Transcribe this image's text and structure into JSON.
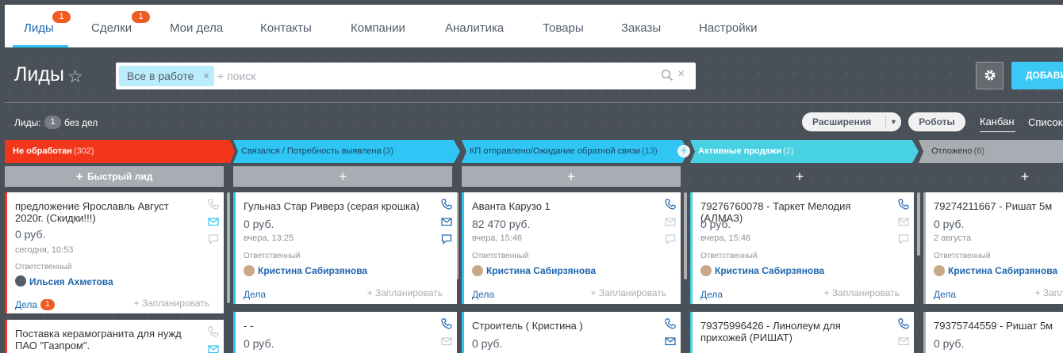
{
  "nav": {
    "tabs": [
      {
        "label": "Лиды",
        "badge": "1"
      },
      {
        "label": "Сделки",
        "badge": "1"
      },
      {
        "label": "Мои дела"
      },
      {
        "label": "Контакты"
      },
      {
        "label": "Компании"
      },
      {
        "label": "Аналитика"
      },
      {
        "label": "Товары"
      },
      {
        "label": "Заказы"
      },
      {
        "label": "Настройки"
      }
    ]
  },
  "page": {
    "title": "Лиды"
  },
  "filter": {
    "chip": "Все в работе",
    "chip_remove": "×",
    "placeholder": "+ поиск",
    "clear": "×"
  },
  "toolbar": {
    "add_label": "ДОБАВИТЬ"
  },
  "counter": {
    "label": "Лиды:",
    "value": "1",
    "suffix": "без дел"
  },
  "actions": {
    "extensions": "Расширения",
    "robots": "Роботы",
    "view_kanban": "Канбан",
    "view_list": "Список"
  },
  "colors": {
    "not_processed": "#f1361b",
    "contacted": "#2fc6f6",
    "proposal": "#2fc6f6",
    "active_sales": "#47d1e2",
    "postponed": "#a8adb4",
    "link": "#2067b0",
    "badge": "#f05b22"
  },
  "columns": [
    {
      "title": "Не обработан",
      "count": "(302)",
      "plus": "+",
      "quick_label": "Быстрый лид",
      "cards": [
        {
          "title": "предложение Ярославль Август 2020г. (Скидки!!!)",
          "sum": "0 руб.",
          "date": "сегодня, 10:53",
          "resp_label": "Ответственный",
          "resp": "Ильсия Ахметова",
          "deals": "Дела",
          "deals_badge": "1",
          "plan": "+ Запланировать"
        },
        {
          "title": "Поставка керамогранита для нужд ПАО \"Газпром\"."
        }
      ]
    },
    {
      "title": "Связался / Потребность выявлена",
      "count": "(3)",
      "plus": "+",
      "cards": [
        {
          "title": "Гульназ Стар Риверз (серая крошка)",
          "sum": "0 руб.",
          "date": "вчера, 13:25",
          "resp_label": "Ответственный",
          "resp": "Кристина Сабирзянова",
          "deals": "Дела",
          "plan": "+ Запланировать"
        },
        {
          "title": "- -",
          "sum": "0 руб."
        }
      ]
    },
    {
      "title": "КП отправлено/Ожидание обратной связи",
      "count": "(13)",
      "plus": "+",
      "cards": [
        {
          "title": "Аванта Карузо 1",
          "sum": "82 470 руб.",
          "date": "вчера, 15:46",
          "resp_label": "Ответственный",
          "resp": "Кристина Сабирзянова",
          "deals": "Дела",
          "plan": "+ Запланировать"
        },
        {
          "title": "Строитель ( Кристина )",
          "sum": "0 руб."
        }
      ]
    },
    {
      "title": "Активные продажи",
      "count": "(2)",
      "plus": "+",
      "cards": [
        {
          "title": "79276760078 - Таркет Мелодия (АЛМАЗ)",
          "sum": "0 руб.",
          "date": "вчера, 15:46",
          "resp_label": "Ответственный",
          "resp": "Кристина Сабирзянова",
          "deals": "Дела",
          "plan": "+ Запланировать"
        },
        {
          "title": "79375996426 - Линолеум для прихожей (РИШАТ)"
        }
      ]
    },
    {
      "title": "Отложено",
      "count": "(6)",
      "plus": "+",
      "cards": [
        {
          "title": "79274211667 - Ришат 5м",
          "sum": "0 руб.",
          "date": "2 августа",
          "resp_label": "Ответственный",
          "resp": "Кристина Сабирзянова",
          "deals": "Дела",
          "plan": "+ Запланировать"
        },
        {
          "title": "79375744559 - Ришат 5м",
          "sum": "0 руб."
        }
      ]
    }
  ]
}
